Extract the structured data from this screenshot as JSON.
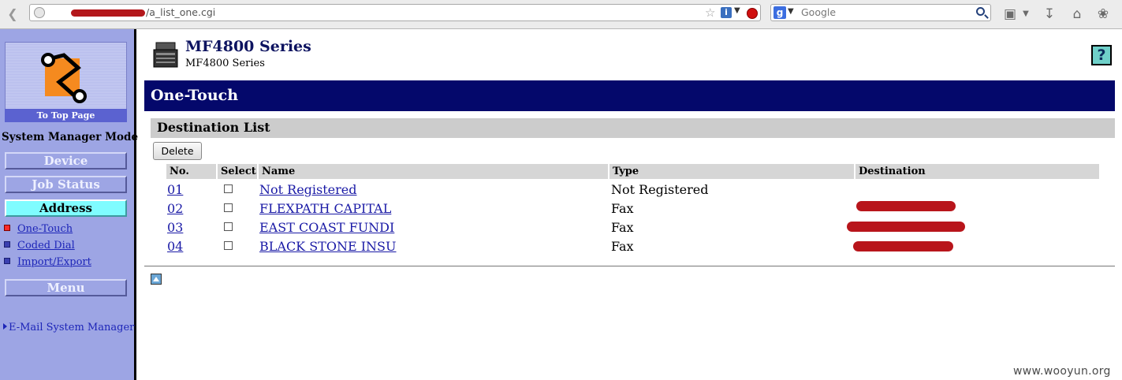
{
  "browser": {
    "url_suffix": "/a_list_one.cgi",
    "search_placeholder": "Google"
  },
  "sidebar": {
    "top_page_label": "To Top Page",
    "mode_label": "System Manager Mode",
    "buttons": [
      {
        "label": "Device",
        "active": false
      },
      {
        "label": "Job Status",
        "active": false
      },
      {
        "label": "Address",
        "active": true
      }
    ],
    "sub_items": [
      {
        "label": "One-Touch",
        "current": true
      },
      {
        "label": "Coded Dial",
        "current": false
      },
      {
        "label": "Import/Export",
        "current": false
      }
    ],
    "menu_label": "Menu",
    "email_link": "E-Mail System Manager"
  },
  "header": {
    "product_title": "MF4800 Series",
    "product_subtitle": "MF4800 Series",
    "help_label": "?"
  },
  "page": {
    "title": "One-Touch",
    "section_title": "Destination List",
    "delete_label": "Delete"
  },
  "table": {
    "columns": [
      "No.",
      "Select",
      "Name",
      "Type",
      "Destination"
    ],
    "rows": [
      {
        "no": "01",
        "name": "Not Registered",
        "type": "Not Registered",
        "destination_redacted": false
      },
      {
        "no": "02",
        "name": "FLEXPATH CAPITAL",
        "type": "Fax",
        "destination_redacted": true
      },
      {
        "no": "03",
        "name": "EAST COAST FUNDI",
        "type": "Fax",
        "destination_redacted": true
      },
      {
        "no": "04",
        "name": "BLACK STONE INSU",
        "type": "Fax",
        "destination_redacted": true
      }
    ]
  },
  "watermark": "www.wooyun.org",
  "colors": {
    "sidebar_bg": "#9da5e4",
    "title_bar_bg": "#04086b",
    "active_button_bg": "#7ffcff",
    "link": "#1a1aa6",
    "redaction": "#b8151b"
  }
}
